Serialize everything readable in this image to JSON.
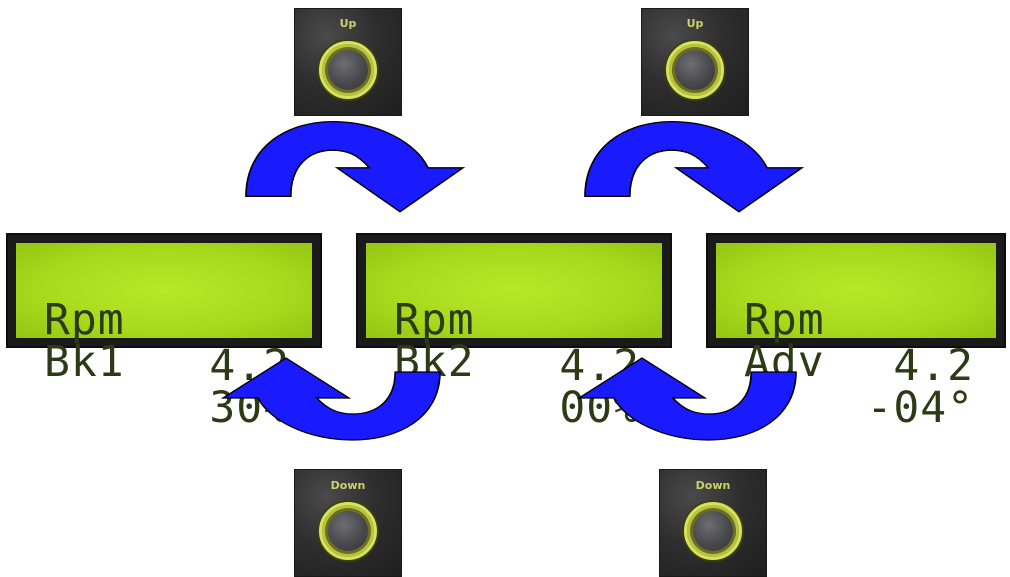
{
  "buttons": {
    "up_left": {
      "label": "Up"
    },
    "up_right": {
      "label": "Up"
    },
    "down_left": {
      "label": "Down"
    },
    "down_right": {
      "label": "Down"
    }
  },
  "screens": [
    {
      "line1_key": "Rpm",
      "line1_value": "4.2",
      "line2_key": "Bk1",
      "line2_value": "30%"
    },
    {
      "line1_key": "Rpm",
      "line1_value": "4.2",
      "line2_key": "Bk2",
      "line2_value": "00%"
    },
    {
      "line1_key": "Rpm",
      "line1_value": "4.2",
      "line2_key": "Adv",
      "line2_value": "-04°"
    }
  ],
  "colors": {
    "arrow_fill": "#1a1aff",
    "arrow_stroke": "#000000",
    "lcd_green": "#a7d91c",
    "lcd_text": "#2c3b16",
    "button_ring": "#d8e25e"
  }
}
